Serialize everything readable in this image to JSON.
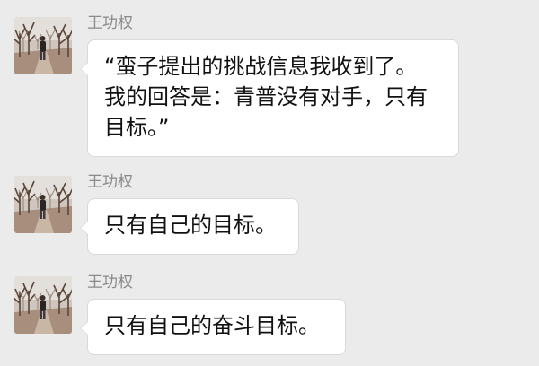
{
  "chat": {
    "messages": [
      {
        "sender": "王功权",
        "avatar_icon": "orchard-photo-avatar",
        "lines": [
          "“蛮子提出的挑战信息我收到了。",
          "我的回答是：青普没有对手，只有",
          "目标。”"
        ]
      },
      {
        "sender": "王功权",
        "avatar_icon": "orchard-photo-avatar",
        "lines": [
          "只有自己的目标。"
        ]
      },
      {
        "sender": "王功权",
        "avatar_icon": "orchard-photo-avatar",
        "lines": [
          "只有自己的奋斗目标。"
        ]
      }
    ]
  }
}
